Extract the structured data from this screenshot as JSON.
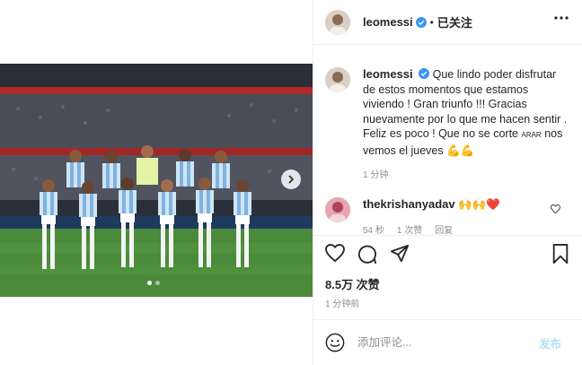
{
  "post": {
    "username": "leomessi",
    "follow_state": "已关注",
    "separator": "•",
    "caption_line1": "Que lindo poder disfrutar de estos momentos que estamos viviendo ! Gran triunfo !!! Gracias nuevamente por lo que me hacen sentir . Feliz es poco ! Que no se corte ",
    "caption_smallcaps": "ARAR",
    "caption_line2": " nos vemos el jueves ",
    "caption_emojis": "💪💪",
    "caption_time": "1 分钟",
    "photo_alt": "Argentina national team lineup photo"
  },
  "comment": {
    "username": "thekrishanyadav",
    "text": "🙌🙌❤️",
    "meta_time": "54 秒",
    "meta_likes": "1 次赞",
    "meta_reply": "回复"
  },
  "stats": {
    "likes": "8.5万 次赞",
    "time_ago": "1 分钟前"
  },
  "composer": {
    "placeholder": "添加评论...",
    "post_label": "发布"
  },
  "carousel": {
    "count": 2,
    "active_index": 0
  },
  "colors": {
    "verified": "#3897f0",
    "red_heart": "#ed4956",
    "pitch": "#4a8a3a"
  }
}
